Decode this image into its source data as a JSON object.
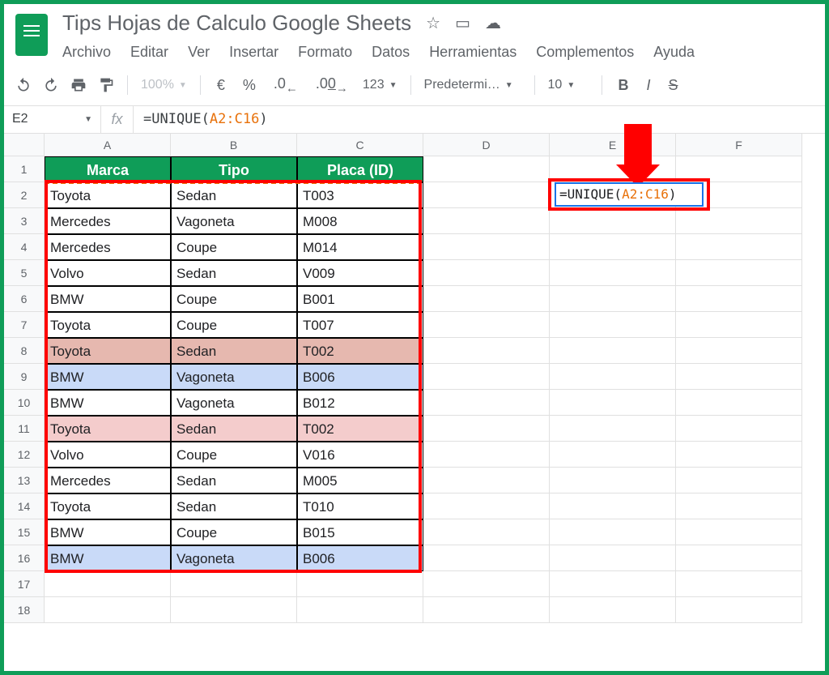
{
  "doc_title": "Tips Hojas de Calculo Google Sheets",
  "menus": [
    "Archivo",
    "Editar",
    "Ver",
    "Insertar",
    "Formato",
    "Datos",
    "Herramientas",
    "Complementos",
    "Ayuda"
  ],
  "toolbar": {
    "zoom": "100%",
    "currency": "€",
    "percent": "%",
    "dec_dec": ".0",
    "dec_inc": ".00",
    "numfmt": "123",
    "font": "Predetermi…",
    "size": "10",
    "bold": "B",
    "italic": "I",
    "strike": "S"
  },
  "name_box": "E2",
  "formula_prefix": "=UNIQUE(",
  "formula_range": "A2:C16",
  "formula_suffix": ")",
  "columns": [
    "A",
    "B",
    "C",
    "D",
    "E",
    "F"
  ],
  "headers": {
    "A": "Marca",
    "B": "Tipo",
    "C": "Placa (ID)"
  },
  "rows": [
    {
      "n": 1
    },
    {
      "n": 2,
      "A": "Toyota",
      "B": "Sedan",
      "C": "T003"
    },
    {
      "n": 3,
      "A": "Mercedes",
      "B": "Vagoneta",
      "C": "M008"
    },
    {
      "n": 4,
      "A": "Mercedes",
      "B": "Coupe",
      "C": "M014"
    },
    {
      "n": 5,
      "A": "Volvo",
      "B": "Sedan",
      "C": "V009"
    },
    {
      "n": 6,
      "A": "BMW",
      "B": "Coupe",
      "C": "B001"
    },
    {
      "n": 7,
      "A": "Toyota",
      "B": "Coupe",
      "C": "T007"
    },
    {
      "n": 8,
      "A": "Toyota",
      "B": "Sedan",
      "C": "T002",
      "cls": "pink"
    },
    {
      "n": 9,
      "A": "BMW",
      "B": "Vagoneta",
      "C": "B006",
      "cls": "blue"
    },
    {
      "n": 10,
      "A": "BMW",
      "B": "Vagoneta",
      "C": "B012"
    },
    {
      "n": 11,
      "A": "Toyota",
      "B": "Sedan",
      "C": "T002",
      "cls": "lpink"
    },
    {
      "n": 12,
      "A": "Volvo",
      "B": "Coupe",
      "C": "V016"
    },
    {
      "n": 13,
      "A": "Mercedes",
      "B": "Sedan",
      "C": "M005"
    },
    {
      "n": 14,
      "A": "Toyota",
      "B": "Sedan",
      "C": "T010"
    },
    {
      "n": 15,
      "A": "BMW",
      "B": "Coupe",
      "C": "B015"
    },
    {
      "n": 16,
      "A": "BMW",
      "B": "Vagoneta",
      "C": "B006",
      "cls": "blue"
    },
    {
      "n": 17
    },
    {
      "n": 18
    }
  ],
  "cell_formula_prefix": "=UNIQUE(",
  "cell_formula_range": "A2:C16",
  "cell_formula_suffix": ")"
}
